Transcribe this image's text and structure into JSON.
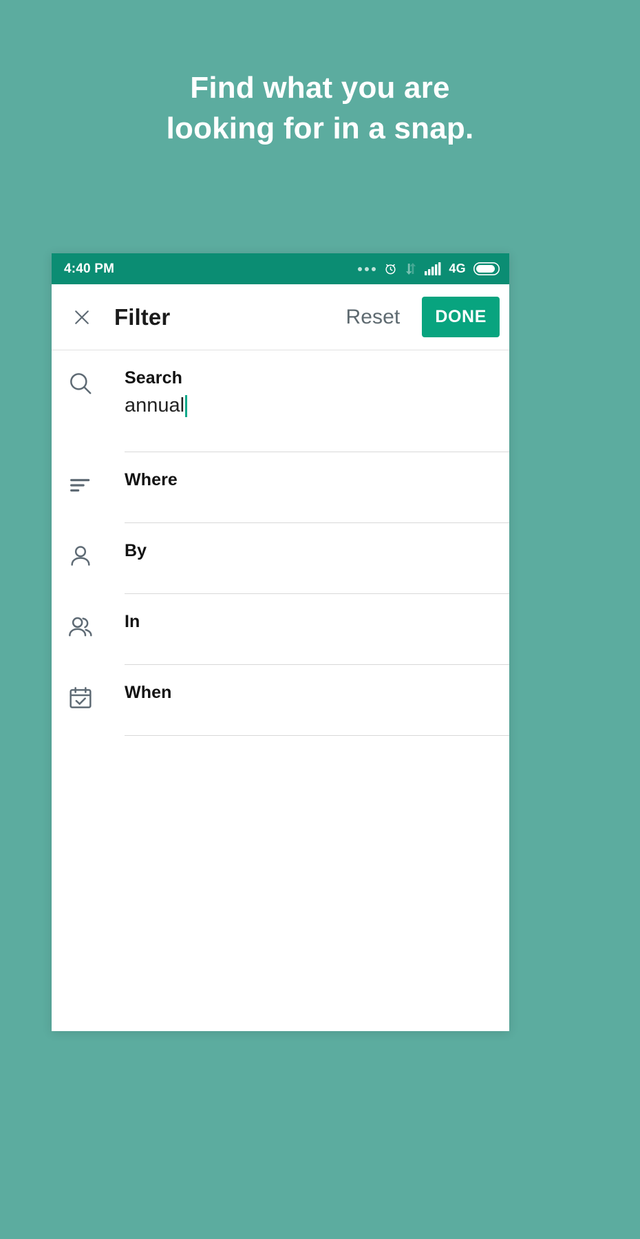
{
  "promo": {
    "line1": "Find what you are",
    "line2": "looking for in a snap.",
    "background_color": "#5cac9f",
    "text_color": "#ffffff"
  },
  "status_bar": {
    "time": "4:40 PM",
    "background_color": "#0b8d73",
    "network_label": "4G",
    "icons": [
      "more-dots-icon",
      "alarm-clock-icon",
      "data-transfer-icon",
      "signal-bars-icon",
      "battery-icon"
    ]
  },
  "app_bar": {
    "close_icon": "close-icon",
    "title": "Filter",
    "reset_label": "Reset",
    "done_label": "DONE",
    "done_color": "#08a47f"
  },
  "filters": [
    {
      "icon": "search-icon",
      "label": "Search",
      "value": "annual",
      "has_caret": true
    },
    {
      "icon": "align-left-icon",
      "label": "Where",
      "value": "",
      "has_caret": false
    },
    {
      "icon": "person-icon",
      "label": "By",
      "value": "",
      "has_caret": false
    },
    {
      "icon": "people-icon",
      "label": "In",
      "value": "",
      "has_caret": false
    },
    {
      "icon": "calendar-check-icon",
      "label": "When",
      "value": "",
      "has_caret": false
    }
  ],
  "colors": {
    "accent": "#08a47f",
    "status_bar": "#0b8d73",
    "page_background": "#5cac9f",
    "caret": "#0fa98a",
    "icon_stroke": "#5e6a74",
    "divider": "#d8d8d8"
  }
}
